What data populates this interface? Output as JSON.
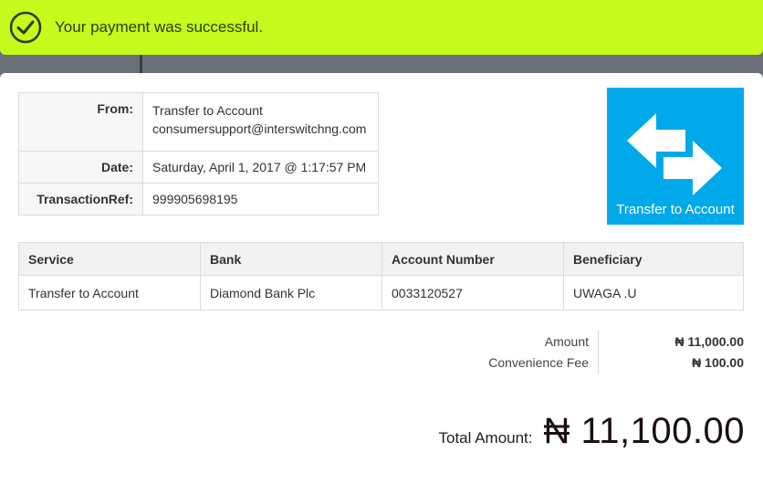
{
  "banner": {
    "message": "Your payment was successful.",
    "icon": "check-circle-icon",
    "color": "#c5fa1c"
  },
  "info": {
    "from_label": "From:",
    "from_line1": "Transfer to Account",
    "from_line2": "consumersupport@interswitchng.com",
    "date_label": "Date:",
    "date_value": "Saturday, April 1, 2017 @ 1:17:57 PM",
    "ref_label": "TransactionRef:",
    "ref_value": "999905698195"
  },
  "logo": {
    "text": "Transfer to Account",
    "icon": "transfer-arrows-icon",
    "color": "#00a9e9"
  },
  "service_table": {
    "headers": [
      "Service",
      "Bank",
      "Account Number",
      "Beneficiary"
    ],
    "row": [
      "Transfer to Account",
      "Diamond Bank Plc",
      "0033120527",
      "UWAGA .U"
    ]
  },
  "amounts": {
    "amount_label": "Amount",
    "amount_value": "₦ 11,000.00",
    "fee_label": "Convenience Fee",
    "fee_value": "₦ 100.00"
  },
  "total": {
    "label": "Total Amount:",
    "value": "₦ 11,100.00"
  }
}
